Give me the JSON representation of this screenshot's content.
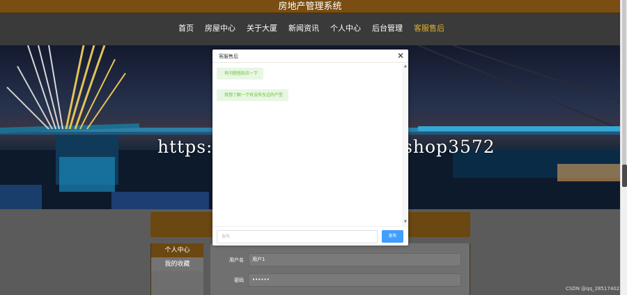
{
  "site": {
    "title": "房地产管理系统"
  },
  "nav": {
    "items": [
      {
        "label": "首页"
      },
      {
        "label": "房屋中心"
      },
      {
        "label": "关于大厦"
      },
      {
        "label": "新闻资讯"
      },
      {
        "label": "个人中心"
      },
      {
        "label": "后台管理"
      },
      {
        "label": "客服售后"
      }
    ],
    "active_color": "#e1b12c"
  },
  "watermark": "https://www.huzhan.com/ishop3572",
  "sidebar": {
    "items": [
      {
        "label": "个人中心"
      },
      {
        "label": "我的收藏"
      }
    ]
  },
  "profile_form": {
    "username_label": "用户名",
    "username_value": "用户1",
    "password_label": "密码",
    "password_value": "••••••"
  },
  "chat_modal": {
    "title": "客服售后",
    "close_icon": "close-icon",
    "messages": [
      {
        "text": "有问题想反应一下"
      },
      {
        "text": "我想了解一下有没有东边的户型"
      }
    ],
    "input_placeholder": "发布",
    "send_label": "发布"
  },
  "footer_mark": "CSDN @qq_28517402",
  "colors": {
    "brand_gold": "#7a4e12",
    "send_button": "#409eff",
    "bubble_text": "#67c23a"
  }
}
